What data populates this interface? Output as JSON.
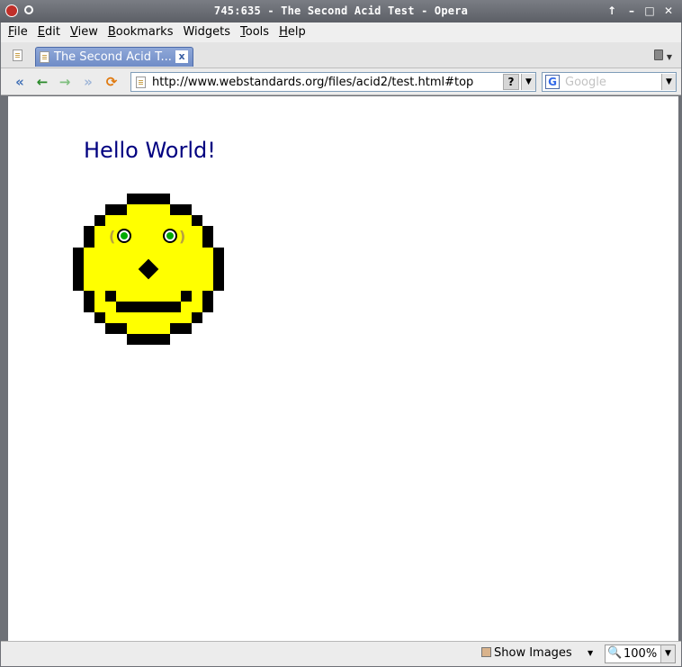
{
  "window": {
    "title": "745:635 - The Second Acid Test - Opera"
  },
  "menu": {
    "items": [
      {
        "label": "File",
        "accel": "F",
        "rest": "ile"
      },
      {
        "label": "Edit",
        "accel": "E",
        "rest": "dit"
      },
      {
        "label": "View",
        "accel": "V",
        "rest": "iew"
      },
      {
        "label": "Bookmarks",
        "accel": "B",
        "rest": "ookmarks"
      },
      {
        "label": "Widgets",
        "accel": "",
        "rest": "Widgets"
      },
      {
        "label": "Tools",
        "accel": "T",
        "rest": "ools"
      },
      {
        "label": "Help",
        "accel": "H",
        "rest": "elp"
      }
    ]
  },
  "tab": {
    "title": "The Second Acid T...",
    "close": "x"
  },
  "address": {
    "url": "http://www.webstandards.org/files/acid2/test.html#top",
    "help": "?"
  },
  "search": {
    "placeholder": "Google",
    "engine_icon": "G"
  },
  "page": {
    "heading": "Hello World!"
  },
  "status": {
    "show_images": "Show Images",
    "zoom": "100%"
  },
  "colors": {
    "face": "#ffff00",
    "outline": "#000000",
    "heading": "#000080",
    "eye": "#00aa00"
  },
  "icons": [
    "opera-logo-icon",
    "pin-icon",
    "up-icon",
    "minimize-icon",
    "maximize-icon",
    "close-icon",
    "new-page-icon",
    "trash-icon",
    "rewind-icon",
    "back-icon",
    "forward-icon",
    "fast-forward-icon",
    "reload-icon",
    "page-icon",
    "google-icon",
    "image-icon",
    "zoom-icon"
  ]
}
